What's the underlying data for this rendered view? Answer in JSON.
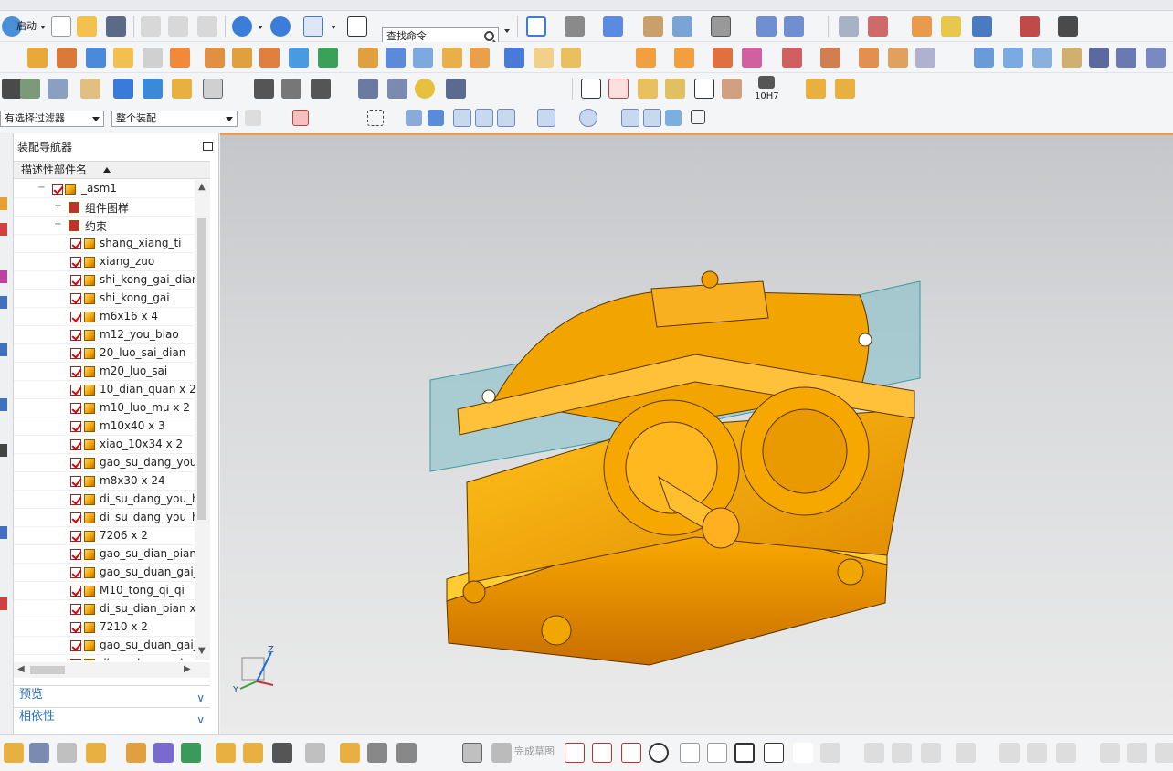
{
  "toolbar": {
    "start_label": "启动",
    "search_placeholder": "查找命令",
    "tol_label": "10H7"
  },
  "selection": {
    "filter": "有选择过滤器",
    "scope": "整个装配"
  },
  "navigator": {
    "title": "装配导航器",
    "column": "描述性部件名",
    "root": "_asm1",
    "groups": [
      "组件图样",
      "约束"
    ],
    "parts": [
      "shang_xiang_ti",
      "xiang_zuo",
      "shi_kong_gai_dian",
      "shi_kong_gai",
      "m6x16 x 4",
      "m12_you_biao",
      "20_luo_sai_dian",
      "m20_luo_sai",
      "10_dian_quan x 2",
      "m10_luo_mu x 2",
      "m10x40 x 3",
      "xiao_10x34 x 2",
      "gao_su_dang_you",
      "m8x30 x 24",
      "di_su_dang_you_h",
      "di_su_dang_you_h",
      "7206 x 2",
      "gao_su_dian_pian",
      "gao_su_duan_gai_",
      "M10_tong_qi_qi",
      "di_su_dian_pian x",
      "7210 x 2",
      "gao_su_duan_gai_",
      "di_su_duan_gai_sh"
    ],
    "preview_label": "预览",
    "dependency_label": "相依性"
  },
  "bottom": {
    "finish_sketch_label": "完成草图"
  },
  "triad": {
    "z_label": "Z",
    "y_label": "Y"
  }
}
